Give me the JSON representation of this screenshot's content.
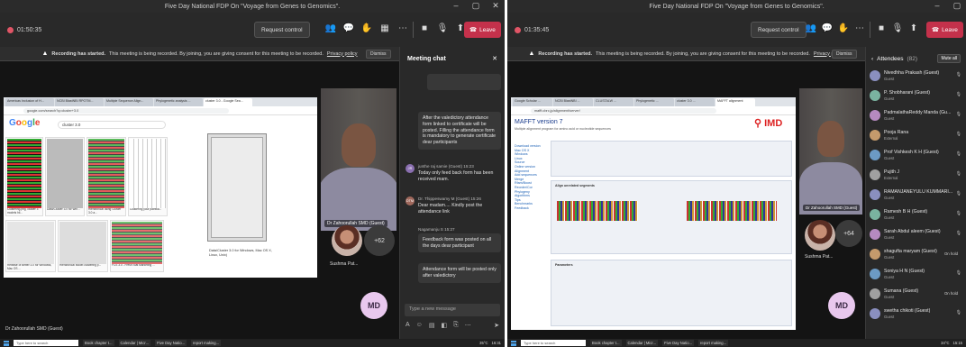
{
  "left": {
    "title": "Five Day National FDP On \"Voyage from Genes to Genomics\".",
    "timer": "01:50:35",
    "request_control": "Request control",
    "leave": "Leave",
    "banner": {
      "title": "Recording has started.",
      "text": "This meeting is being recorded. By joining, you are giving consent for this meeting to be recorded.",
      "link": "Privacy policy",
      "dismiss": "Dismiss"
    },
    "presenter_label": "Dr Zahoorullah SMD (Guest)",
    "footer_name": "Dr Zahoorullah SMD (Guest)",
    "tile_name": "Sushma Pat...",
    "more_count": "+62",
    "self_initials": "MD",
    "shared": {
      "search_query": "cluster 3.0",
      "dialog_caption_1": "Data/Cluster 3.0 for Windows, Mac OS X,",
      "dialog_caption_2": "Linux, Unix)",
      "thumb_captions": [
        "Clustering.png, cluster 3 models hil...",
        "Data/Cluster 3.0 for Win...",
        "Hierarchical using Cluster 3.0 a...",
        "Clustering your pathwa..."
      ],
      "thumb_captions_row2": [
        "Release of Better 3.0 for Windows, Mac OS ...",
        "Hierarchical Model clustering p...",
        "FCS 3.0 - Fresh Stat Marketing ..."
      ]
    },
    "chat": {
      "title": "Meeting chat",
      "messages": [
        {
          "text": "After the valedictory attendance form linked to certificate will be posted. Filling the attendance form is mandatory to generate certificate dear participants"
        },
        {
          "author": "junthe raj samie (Guest) 15:23",
          "text": "Today only feed back form has been received mam.",
          "initials": "JR"
        },
        {
          "author": "Dr. Thippeswamy M (Guest) 15:26",
          "text": "Dear madam.... Kindly post the attendance link",
          "initials": "DTM"
        },
        {
          "author": "Nagamanju S 15:27",
          "text": "Feedback form was posted on all the days dear participant"
        },
        {
          "text": "Attendance form will be posted only after valedictory"
        }
      ],
      "input_placeholder": "Type a new message"
    },
    "taskbar": {
      "search": "Type here to search",
      "apps": [
        "Book chapter t...",
        "Calendar | Micr...",
        "Five Day Natio...",
        "report making..."
      ],
      "weather": "35°C",
      "time": "16:31"
    }
  },
  "right": {
    "title": "Five Day National FDP On \"Voyage from Genes to Genomics\".",
    "timer": "01:35:45",
    "request_control": "Request control",
    "leave": "Leave",
    "banner": {
      "title": "Recording has started.",
      "text": "This meeting is being recorded. By joining, you are giving consent for this meeting to be recorded.",
      "link": "Privacy policy",
      "dismiss": "Dismiss"
    },
    "presenter_label": "Dr Zahoorullah SMD (Guest)",
    "tile_name": "Sushma Pat...",
    "more_count": "+64",
    "self_initials": "MD",
    "shared": {
      "title": "MAFFT version 7",
      "subtitle": "Multiple alignment program for amino acid or nucleotide sequences",
      "logo": "IMD",
      "nav": [
        "Download version",
        "Mac OS X",
        "Windows",
        "Linux",
        "Source",
        "Online version",
        "Alignment",
        "Add sequences",
        "Merge",
        "Rfam/Boost",
        "Reorder/Cor",
        "Phylogeny",
        "Algorithms",
        "Tips",
        "Benchmarks",
        "Feedback"
      ],
      "section1": "Align unrelated segments",
      "section2": "Parameters"
    },
    "attendees": {
      "title": "Attendees",
      "count": "(82)",
      "mute_all": "Mute all",
      "list": [
        {
          "name": "Nivedhha Prakash (Guest)",
          "role": "Guest"
        },
        {
          "name": "P. Shobharani (Guest)",
          "role": "Guest"
        },
        {
          "name": "PadmalathaReddy Manda (Gu...",
          "role": "Guest"
        },
        {
          "name": "Pooja Rana",
          "role": "External"
        },
        {
          "name": "Prof Vishkesh K H (Guest)",
          "role": "Guest"
        },
        {
          "name": "Pujith J",
          "role": "External"
        },
        {
          "name": "RAMANJANEYULU KUMMARI...",
          "role": "Guest"
        },
        {
          "name": "Ramesh B H (Guest)",
          "role": "Guest"
        },
        {
          "name": "Sarah Abdul aleem (Guest)",
          "role": "Guest"
        },
        {
          "name": "shagufta maryam (Guest)",
          "role": "Guest",
          "status": "On hold"
        },
        {
          "name": "Soniya H N (Guest)",
          "role": "Guest"
        },
        {
          "name": "Sumana (Guest)",
          "role": "Guest",
          "status": "On hold"
        },
        {
          "name": "swetha chikoti (Guest)",
          "role": "Guest"
        }
      ]
    },
    "taskbar": {
      "search": "Type here to search",
      "apps": [
        "Book chapter t...",
        "Calendar | Micr...",
        "Five Day Natio...",
        "report making..."
      ],
      "weather": "34°C",
      "time": "15:15"
    }
  },
  "colors": {
    "teams_bg": "#1f1f1f",
    "leave_red": "#c4314b",
    "recording_dot": "#e05566",
    "self_avatar": "#e9c8ee"
  }
}
